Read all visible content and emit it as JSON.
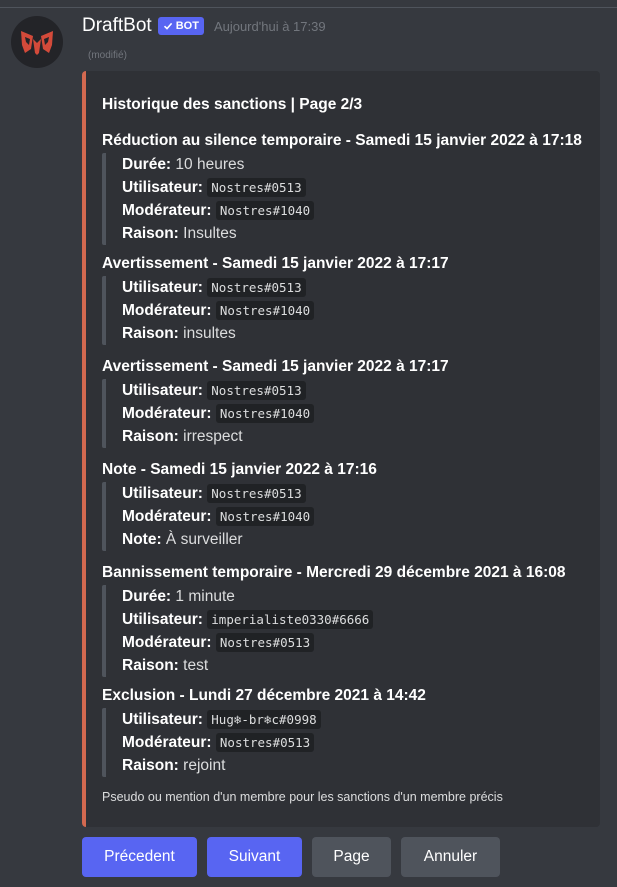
{
  "author": {
    "name": "DraftBot",
    "badge": "BOT",
    "timestamp": "Aujourd'hui à 17:39",
    "edited": "(modifié)",
    "avatar_icon": "draftbot-logo-icon"
  },
  "embed": {
    "accent_color": "#d36950",
    "title": "Historique des sanctions | Page 2/3",
    "sections": [
      {
        "title": "Réduction au silence temporaire - Samedi 15 janvier 2022 à 17:18",
        "fields": [
          {
            "label": "Durée:",
            "value": "10 heures",
            "code": false
          },
          {
            "label": "Utilisateur:",
            "value": "Nostres#0513",
            "code": true
          },
          {
            "label": "Modérateur:",
            "value": "Nostres#1040",
            "code": true
          },
          {
            "label": "Raison:",
            "value": "Insultes",
            "code": false
          }
        ]
      },
      {
        "title": "Avertissement - Samedi 15 janvier 2022 à 17:17",
        "fields": [
          {
            "label": "Utilisateur:",
            "value": "Nostres#0513",
            "code": true
          },
          {
            "label": "Modérateur:",
            "value": "Nostres#1040",
            "code": true
          },
          {
            "label": "Raison:",
            "value": "insultes",
            "code": false
          }
        ]
      },
      {
        "title": "Avertissement - Samedi 15 janvier 2022 à 17:17",
        "fields": [
          {
            "label": "Utilisateur:",
            "value": "Nostres#0513",
            "code": true
          },
          {
            "label": "Modérateur:",
            "value": "Nostres#1040",
            "code": true
          },
          {
            "label": "Raison:",
            "value": "irrespect",
            "code": false
          }
        ]
      },
      {
        "title": "Note - Samedi 15 janvier 2022 à 17:16",
        "fields": [
          {
            "label": "Utilisateur:",
            "value": "Nostres#0513",
            "code": true
          },
          {
            "label": "Modérateur:",
            "value": "Nostres#1040",
            "code": true
          },
          {
            "label": "Note:",
            "value": "À surveiller",
            "code": false
          }
        ]
      },
      {
        "title": "Bannissement temporaire - Mercredi 29 décembre 2021 à 16:08",
        "fields": [
          {
            "label": "Durée:",
            "value": "1 minute",
            "code": false
          },
          {
            "label": "Utilisateur:",
            "value": "imperialiste0330#6666",
            "code": true
          },
          {
            "label": "Modérateur:",
            "value": "Nostres#0513",
            "code": true
          },
          {
            "label": "Raison:",
            "value": "test",
            "code": false
          }
        ]
      },
      {
        "title": "Exclusion - Lundi 27 décembre 2021 à 14:42",
        "fields": [
          {
            "label": "Utilisateur:",
            "value": "Hug❄-br❄c#0998",
            "code": true
          },
          {
            "label": "Modérateur:",
            "value": "Nostres#0513",
            "code": true
          },
          {
            "label": "Raison:",
            "value": "rejoint",
            "code": false
          }
        ]
      }
    ],
    "footer": "Pseudo ou mention d'un membre pour les sanctions d'un membre précis"
  },
  "buttons": [
    {
      "label": "Précedent",
      "style": "primary"
    },
    {
      "label": "Suivant",
      "style": "primary"
    },
    {
      "label": "Page",
      "style": "secondary"
    },
    {
      "label": "Annuler",
      "style": "secondary"
    }
  ],
  "colors": {
    "background": "#36393f",
    "embed_background": "#2f3136",
    "primary_button": "#5865f2",
    "secondary_button": "#4f545c"
  }
}
